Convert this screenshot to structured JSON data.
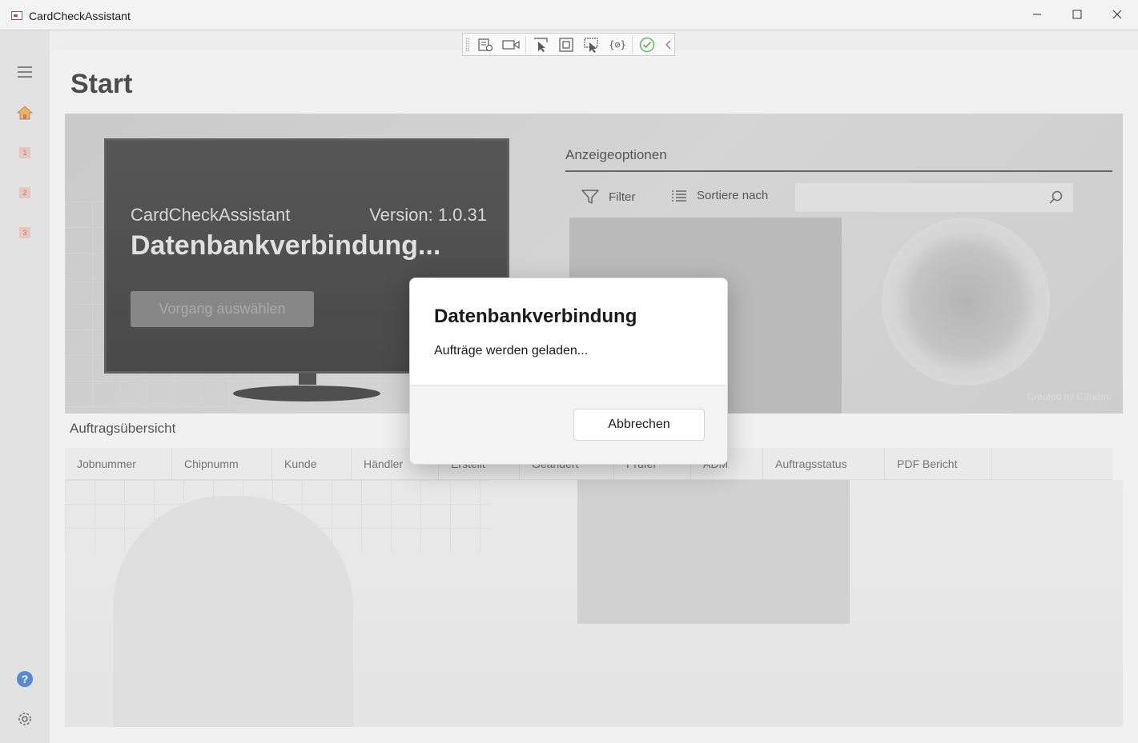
{
  "window": {
    "title": "CardCheckAssistant",
    "controls": {
      "minimize": "—",
      "maximize": "☐",
      "close": "✕"
    }
  },
  "debug_toolbar": {
    "icons": [
      "live-visual-tree-icon",
      "record-icon",
      "select-element-icon",
      "display-layout-adorners-icon",
      "track-focus-icon",
      "binding-failures-icon",
      "hot-reload-ok-icon",
      "collapse-icon"
    ]
  },
  "nav": {
    "items": [
      {
        "name": "home",
        "icon": "home-icon"
      },
      {
        "name": "step-1",
        "label": "1"
      },
      {
        "name": "step-2",
        "label": "2"
      },
      {
        "name": "step-3",
        "label": "3"
      }
    ],
    "help_icon": "help-icon",
    "settings_icon": "gear-icon"
  },
  "page": {
    "title": "Start"
  },
  "hero": {
    "app_name": "CardCheckAssistant",
    "version": "Version: 1.0.31",
    "status": "Datenbankverbindung...",
    "action_button": "Vorgang auswählen",
    "credit": "Created by C3rebro"
  },
  "options": {
    "heading": "Anzeigeoptionen",
    "filter_label": "Filter",
    "sort_label": "Sortiere nach",
    "search_placeholder": ""
  },
  "orders": {
    "heading": "Auftragsübersicht",
    "columns": [
      "Jobnummer",
      "Chipnumm",
      "Kunde",
      "Händler",
      "Erstellt",
      "Geändert",
      "Prüfer",
      "ADM",
      "Auftragsstatus",
      "PDF Bericht"
    ]
  },
  "dialog": {
    "title": "Datenbankverbindung",
    "message": "Aufträge werden geladen...",
    "cancel_button": "Abbrechen"
  },
  "colors": {
    "accent_home": "#e0a020",
    "help_blue": "#1e62c8",
    "check_green": "#2aa52a"
  }
}
